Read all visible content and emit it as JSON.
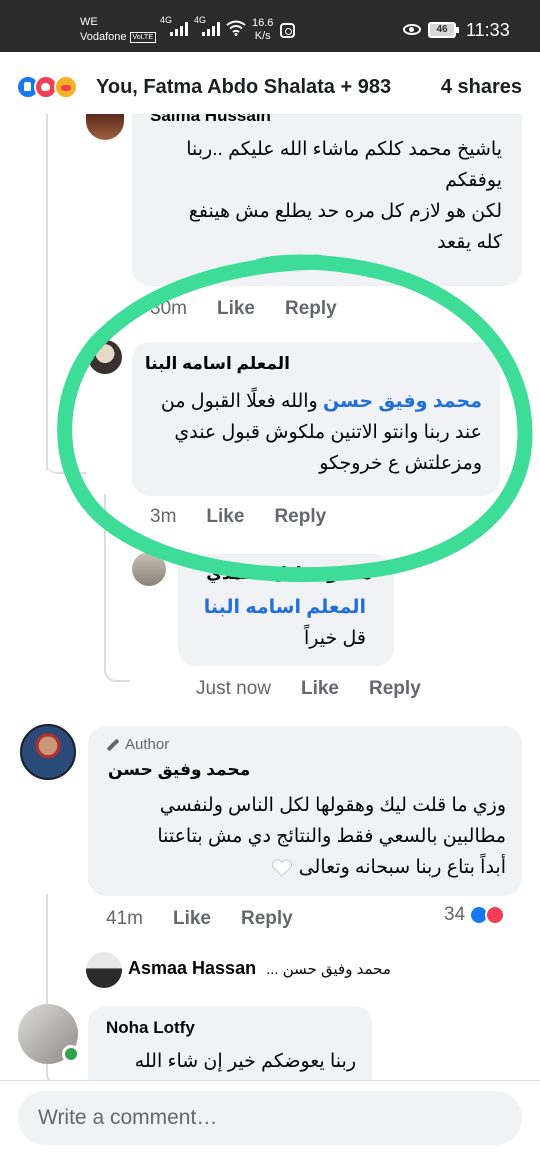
{
  "status_bar": {
    "carrier_short": "WE",
    "carrier": "Vodafone",
    "volte": "VoLTE",
    "net1": "4G",
    "net2": "4G",
    "speed": "16.6",
    "speed_unit": "K/s",
    "battery": "46",
    "time": "11:33"
  },
  "reactions_header": {
    "names": "You, Fatma Abdo Shalata + 983",
    "shares": "4 shares",
    "icons": [
      "like-icon",
      "love-icon",
      "care-icon"
    ]
  },
  "comments": {
    "saima": {
      "name": "Saima Hussain",
      "line1": "ياشيخ محمد كلكم ماشاء الله عليكم ..ربنا",
      "line2": "يوفقكم",
      "line3": "لكن هو لازم كل مره حد يطلع مش هينفع",
      "line4": "كله يقعد",
      "time": "30m",
      "like": "Like",
      "reply": "Reply"
    },
    "moallem": {
      "name": "المعلم اسامه البنا",
      "mention": "محمد وفيق حسن",
      "line1_rest": "والله فعلًا القبول من",
      "line2": "عند ربنا وانتو الاتنين ملكوش قبول عندي",
      "line3": "ومزعلتش ع خروجكو",
      "time": "3m",
      "like": "Like",
      "reply": "Reply"
    },
    "mahmoud": {
      "name": "محمود عادل الحمدي",
      "mention": "المعلم اسامه البنا",
      "text": "قل خيراً",
      "time": "Just now",
      "like": "Like",
      "reply": "Reply"
    },
    "author": {
      "badge": "Author",
      "name": "محمد وفيق حسن",
      "line1": "وزي ما قلت ليك وهقولها لكل الناس ولنفسي",
      "line2": "مطالبين بالسعي فقط والنتائج دي مش بتاعتنا",
      "line3": "أبداً بتاع ربنا سبحانه وتعالى",
      "time": "41m",
      "like": "Like",
      "reply": "Reply",
      "reaction_count": "34"
    },
    "asmaa": {
      "name": "Asmaa Hassan",
      "snippet": "محمد وفيق حسن ..."
    },
    "noha": {
      "name": "Noha Lotfy",
      "text": "ربنا يعوضكم خير إن شاء الله"
    }
  },
  "composer": {
    "placeholder": "Write a comment…"
  },
  "colors": {
    "accent": "#1877f2",
    "mention": "#216fdb",
    "bubble": "#f0f2f5",
    "annotation": "#3ddc97"
  }
}
